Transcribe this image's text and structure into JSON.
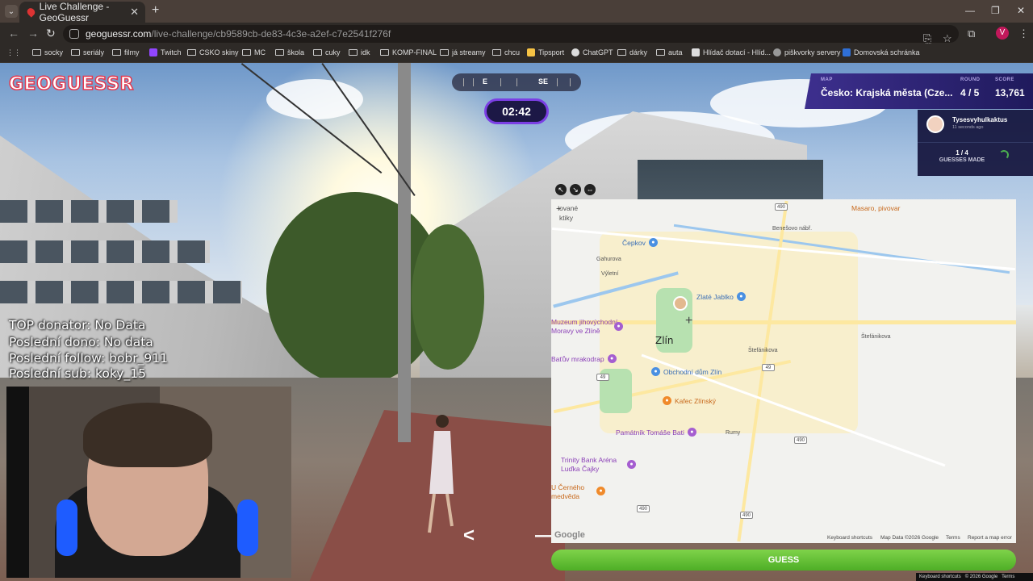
{
  "browser": {
    "tab_title": "Live Challenge - GeoGuessr",
    "url_host": "geoguessr.com",
    "url_path": "/live-challenge/cb9589cb-de83-4c3e-a2ef-c7e2541f276f",
    "profile_initial": "V",
    "bookmarks": [
      "socky",
      "seriály",
      "filmy",
      "Twitch",
      "CSKO skiny",
      "MC",
      "škola",
      "cuky",
      "idk",
      "KOMP-FINAL",
      "já streamy",
      "chcu",
      "Tipsport",
      "ChatGPT",
      "dárky",
      "auta",
      "Hlídač dotací - Hlíd...",
      "piškvorky servery",
      "Domovská schránka"
    ]
  },
  "game": {
    "logo": "GEOGUESSR",
    "compass": {
      "left": "E",
      "right": "SE"
    },
    "timer": "02:42",
    "map_label": "MAP",
    "map_name": "Česko: Krajská města (Cze...",
    "round_label": "ROUND",
    "round_value": "4 / 5",
    "score_label": "SCORE",
    "score_value": "13,761",
    "player_name": "Tysesvyhulkaktus",
    "player_time": "11 seconds ago",
    "guesses_count": "1 / 4",
    "guesses_label": "GUESSES MADE",
    "guess_button": "GUESS"
  },
  "stream_overlay": {
    "line1": "TOP donator: No Data",
    "line2": "Poslední dono: No data",
    "line3": "Poslední follow: bobr_911",
    "line4": "Poslední sub: koky_15"
  },
  "map": {
    "city": "Zlín",
    "places": [
      "Čepkov",
      "Zlaté Jablko",
      "Muzeum jihovýchodní Moravy ve Zlíně",
      "Baťův mrakodrap",
      "Obchodní dům Zlín",
      "Kafec Zlínský",
      "Památník Tomáše Bati",
      "Trinity Bank Aréna Luďka Čajky",
      "U Černého medvěda",
      "Masaro, pivovar",
      "Gahurova",
      "Výletní",
      "Benešovo nábř.",
      "Štefánikova",
      "Rumy",
      "ované",
      "ktiky"
    ],
    "shields": [
      "490",
      "49",
      "49",
      "490",
      "490",
      "490"
    ],
    "footer": [
      "Keyboard shortcuts",
      "Map Data ©2026 Google",
      "Terms",
      "Report a map error"
    ],
    "google": "Google"
  },
  "page_footer": [
    "Keyboard shortcuts",
    "© 2026 Google",
    "Terms"
  ]
}
